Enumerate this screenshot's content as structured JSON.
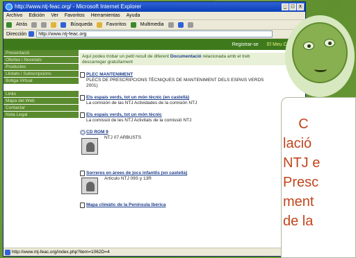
{
  "browser": {
    "title": "http://www.ntj-feac.org/ - Microsoft Internet Explorer",
    "window_controls": [
      "_",
      "□",
      "x"
    ],
    "menu": [
      "Archivo",
      "Edición",
      "Ver",
      "Favoritos",
      "Herramientas",
      "Ayuda"
    ],
    "toolbar": [
      "Atrás",
      "Búsqueda",
      "Favoritos",
      "Multimedia"
    ],
    "address_label": "Dirección",
    "address_value": "http://www.ntj-feac.org",
    "status": "http://www.ntj-feac.org/index.php?item=1062D=4"
  },
  "site": {
    "topnav": [
      "Registrar-se",
      "El Meu Carret"
    ],
    "sidebar": [
      "Presentació",
      "Ofertes i Novetats",
      "Productes",
      "Llistats i Subscripcions",
      "Botiga Virtual",
      "Links",
      "Mapa del Web",
      "Contactar",
      "Nota Legal"
    ],
    "intro_prefix": "Aquí podeu trobar un petit recull de diferent ",
    "intro_bold": "Documentació",
    "intro_suffix": " relacionada amb el treb",
    "intro_line2": "descarregar gratuïtament",
    "entries": [
      {
        "title": "PLEC MANTENIMENT",
        "desc": "PLECS DE PRESCRIPCIONS TÈCNIQUES DE MANTENIMENT DELS ESPAIS VERDS",
        "desc2": "2001)"
      },
      {
        "title": "Els espais verds, tot un món tècnic (en castellà)",
        "desc": "La comisión de las NTJ Actividades de la comisión NTJ"
      },
      {
        "title": "Els espais verds, tot un món tècnic",
        "desc": "La comissió de les NTJ Activitats de la comissió NTJ"
      },
      {
        "title": "CD ROM 9",
        "desc": "NTJ 07 ARBUSTS"
      },
      {
        "title": "Sorreres en àrees de jocs infantils (en castellà)",
        "desc": "Artículo NTJ 09S y 13R"
      },
      {
        "title": "Mapa climàtic de la Península Ibèrica",
        "desc": ""
      }
    ]
  },
  "overlay": {
    "text_lines": [
      "    C",
      "lació",
      "NTJ e",
      "Presc",
      "ment",
      "de la"
    ]
  }
}
